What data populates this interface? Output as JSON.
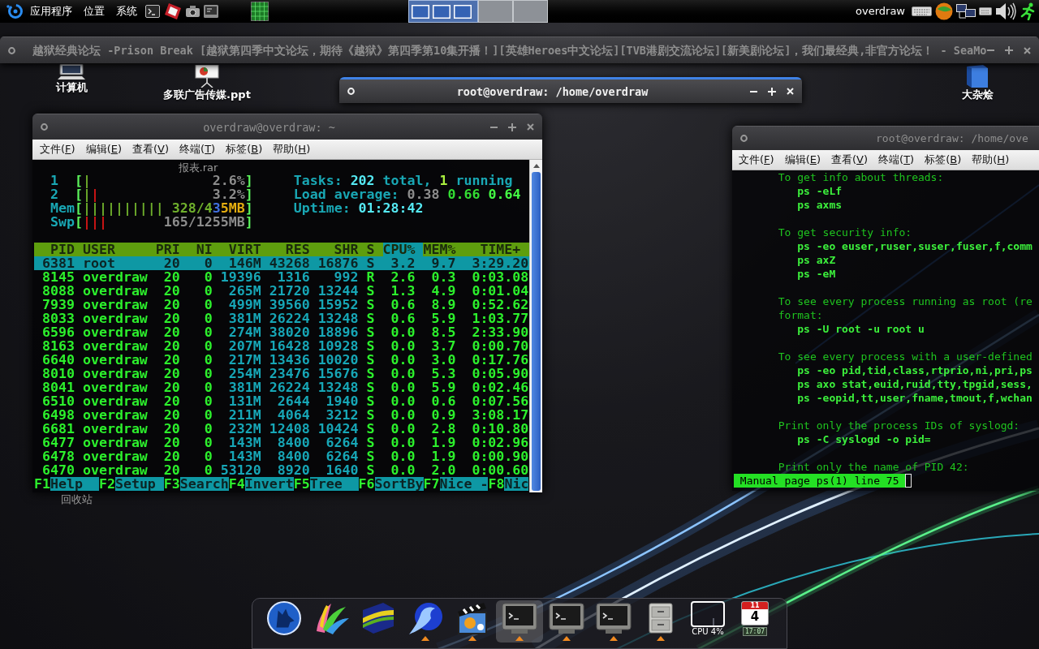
{
  "top_panel": {
    "menus": [
      "应用程序",
      "位置",
      "系统"
    ],
    "workspaces": [
      {
        "selected": true
      },
      {
        "selected": false
      },
      {
        "selected": false
      }
    ],
    "user": "overdraw"
  },
  "desktop_icons": [
    {
      "label": "计算机",
      "covered": false
    },
    {
      "label": "多联广告传媒.ppt",
      "covered": false
    },
    {
      "label": "大杂烩",
      "covered": false
    },
    {
      "label": "报表.rar",
      "covered": true
    },
    {
      "label": "回收站",
      "covered": true
    }
  ],
  "browser_window": {
    "title": "越狱经典论坛 -Prison Break [越狱第四季中文论坛，期待《越狱》第四季第10集开播！][英雄Heroes中文论坛][TVB港剧交流论坛][新美剧论坛]，我们最经典,非官方论坛！ - SeaMo",
    "focused": false
  },
  "terminal_window": {
    "title": "root@overdraw: /home/overdraw",
    "focused": true
  },
  "htop_window": {
    "title": "overdraw@overdraw: ~",
    "focused": false,
    "menu": [
      {
        "text": "文件(",
        "mnemonic": "F",
        "suffix": ")"
      },
      {
        "text": "编辑(",
        "mnemonic": "E",
        "suffix": ")"
      },
      {
        "text": "查看(",
        "mnemonic": "V",
        "suffix": ")"
      },
      {
        "text": "终端(",
        "mnemonic": "T",
        "suffix": ")"
      },
      {
        "text": "标签(",
        "mnemonic": "B",
        "suffix": ")"
      },
      {
        "text": "帮助(",
        "mnemonic": "H",
        "suffix": ")"
      }
    ],
    "htop": {
      "meters": [
        {
          "label": "1",
          "open": "[",
          "bar": [
            {
              "text": "|",
              "kind": "user"
            }
          ],
          "value": [
            {
              "text": "2.6%",
              "kind": "dim"
            }
          ],
          "close": "]"
        },
        {
          "label": "2",
          "open": "[",
          "bar": [
            {
              "text": "|",
              "kind": "user"
            },
            {
              "text": "|",
              "kind": "kernel"
            }
          ],
          "value": [
            {
              "text": "3.2%",
              "kind": "dim"
            }
          ],
          "close": "]"
        },
        {
          "label": "Mem",
          "open": "[",
          "bar": [
            {
              "text": "||||||||||",
              "kind": "user"
            }
          ],
          "value": [
            {
              "text": "328/4",
              "kind": "user"
            },
            {
              "text": "3",
              "kind": "buffers"
            },
            {
              "text": "5MB",
              "kind": "cache"
            }
          ],
          "close": "]"
        },
        {
          "label": "Swp",
          "open": "[",
          "bar": [
            {
              "text": "|||",
              "kind": "kernel"
            }
          ],
          "value": [
            {
              "text": "165/1255MB",
              "kind": "dim"
            }
          ],
          "close": "]"
        }
      ],
      "summary": [
        [
          {
            "text": "Tasks:",
            "kind": "label"
          },
          {
            "text": "202",
            "kind": "value"
          },
          {
            "text": "total,",
            "kind": "label"
          },
          {
            "text": "1",
            "kind": "running"
          },
          {
            "text": "running",
            "kind": "label"
          }
        ],
        [
          {
            "text": "Load average:",
            "kind": "label"
          },
          {
            "text": "0.38",
            "kind": "dim"
          },
          {
            "text": "0.66",
            "kind": "green"
          },
          {
            "text": "0.64",
            "kind": "bright"
          }
        ],
        [
          {
            "text": "Uptime:",
            "kind": "label"
          },
          {
            "text": "01:28:42",
            "kind": "value"
          }
        ]
      ],
      "columns": [
        {
          "label": "PID",
          "selected": false
        },
        {
          "label": "USER",
          "selected": false
        },
        {
          "label": "PRI",
          "selected": false
        },
        {
          "label": "NI",
          "selected": false
        },
        {
          "label": "VIRT",
          "selected": false
        },
        {
          "label": "RES",
          "selected": false
        },
        {
          "label": "SHR",
          "selected": false
        },
        {
          "label": "S",
          "selected": false
        },
        {
          "label": "CPU%",
          "selected": true
        },
        {
          "label": "MEM%",
          "selected": false
        },
        {
          "label": "TIME+",
          "selected": false
        }
      ],
      "rows": [
        {
          "selected": true,
          "cells": [
            "6381",
            "root",
            "20",
            "0",
            "146M",
            "43268",
            "16876",
            "S",
            "3.2",
            "9.7",
            "3:29.20"
          ]
        },
        {
          "selected": false,
          "cells": [
            "8145",
            "overdraw",
            "20",
            "0",
            "19396",
            "1316",
            "992",
            "R",
            "2.6",
            "0.3",
            "0:03.08"
          ]
        },
        {
          "selected": false,
          "cells": [
            "8088",
            "overdraw",
            "20",
            "0",
            "265M",
            "21720",
            "13244",
            "S",
            "1.3",
            "4.9",
            "0:01.04"
          ]
        },
        {
          "selected": false,
          "cells": [
            "7939",
            "overdraw",
            "20",
            "0",
            "499M",
            "39560",
            "15952",
            "S",
            "0.6",
            "8.9",
            "0:52.62"
          ]
        },
        {
          "selected": false,
          "cells": [
            "8033",
            "overdraw",
            "20",
            "0",
            "381M",
            "26224",
            "13248",
            "S",
            "0.6",
            "5.9",
            "1:03.77"
          ]
        },
        {
          "selected": false,
          "cells": [
            "6596",
            "overdraw",
            "20",
            "0",
            "274M",
            "38020",
            "18896",
            "S",
            "0.0",
            "8.5",
            "2:33.90"
          ]
        },
        {
          "selected": false,
          "cells": [
            "8163",
            "overdraw",
            "20",
            "0",
            "207M",
            "16428",
            "10928",
            "S",
            "0.0",
            "3.7",
            "0:00.70"
          ]
        },
        {
          "selected": false,
          "cells": [
            "6640",
            "overdraw",
            "20",
            "0",
            "217M",
            "13436",
            "10020",
            "S",
            "0.0",
            "3.0",
            "0:17.76"
          ]
        },
        {
          "selected": false,
          "cells": [
            "8010",
            "overdraw",
            "20",
            "0",
            "254M",
            "23476",
            "15676",
            "S",
            "0.0",
            "5.3",
            "0:05.90"
          ]
        },
        {
          "selected": false,
          "cells": [
            "8041",
            "overdraw",
            "20",
            "0",
            "381M",
            "26224",
            "13248",
            "S",
            "0.0",
            "5.9",
            "0:02.46"
          ]
        },
        {
          "selected": false,
          "cells": [
            "6510",
            "overdraw",
            "20",
            "0",
            "131M",
            "2644",
            "1940",
            "S",
            "0.0",
            "0.6",
            "0:07.56"
          ]
        },
        {
          "selected": false,
          "cells": [
            "6498",
            "overdraw",
            "20",
            "0",
            "211M",
            "4064",
            "3212",
            "S",
            "0.0",
            "0.9",
            "3:08.17"
          ]
        },
        {
          "selected": false,
          "cells": [
            "6681",
            "overdraw",
            "20",
            "0",
            "232M",
            "12408",
            "10424",
            "S",
            "0.0",
            "2.8",
            "0:10.80"
          ]
        },
        {
          "selected": false,
          "cells": [
            "6477",
            "overdraw",
            "20",
            "0",
            "143M",
            "8400",
            "6264",
            "S",
            "0.0",
            "1.9",
            "0:02.96"
          ]
        },
        {
          "selected": false,
          "cells": [
            "6478",
            "overdraw",
            "20",
            "0",
            "143M",
            "8400",
            "6264",
            "S",
            "0.0",
            "1.9",
            "0:00.90"
          ]
        },
        {
          "selected": false,
          "cells": [
            "6470",
            "overdraw",
            "20",
            "0",
            "53120",
            "8920",
            "1640",
            "S",
            "0.0",
            "2.0",
            "0:00.60"
          ]
        }
      ],
      "keys": [
        {
          "key": "F1",
          "label": "Help"
        },
        {
          "key": "F2",
          "label": "Setup"
        },
        {
          "key": "F3",
          "label": "Search"
        },
        {
          "key": "F4",
          "label": "Invert"
        },
        {
          "key": "F5",
          "label": "Tree"
        },
        {
          "key": "F6",
          "label": "SortBy"
        },
        {
          "key": "F7",
          "label": "Nice -"
        },
        {
          "key": "F8",
          "label": "Nic"
        }
      ]
    }
  },
  "man_window": {
    "title": "root@overdraw: /home/ove",
    "focused": false,
    "menu": [
      {
        "text": "文件(",
        "mnemonic": "F",
        "suffix": ")"
      },
      {
        "text": "编辑(",
        "mnemonic": "E",
        "suffix": ")"
      },
      {
        "text": "查看(",
        "mnemonic": "V",
        "suffix": ")"
      },
      {
        "text": "终端(",
        "mnemonic": "T",
        "suffix": ")"
      },
      {
        "text": "标签(",
        "mnemonic": "B",
        "suffix": ")"
      },
      {
        "text": "帮助(",
        "mnemonic": "H",
        "suffix": ")"
      }
    ],
    "lines": [
      {
        "kind": "text",
        "text": "To get info about threads:"
      },
      {
        "kind": "command",
        "text": "ps -eLf"
      },
      {
        "kind": "command",
        "text": "ps axms"
      },
      {
        "kind": "gap"
      },
      {
        "kind": "text",
        "text": "To get security info:"
      },
      {
        "kind": "command",
        "text": "ps -eo euser,ruser,suser,fuser,f,comm"
      },
      {
        "kind": "command",
        "text": "ps axZ"
      },
      {
        "kind": "command",
        "text": "ps -eM"
      },
      {
        "kind": "gap"
      },
      {
        "kind": "text",
        "text": "To see every process running as root (re"
      },
      {
        "kind": "text",
        "text": "format:"
      },
      {
        "kind": "command",
        "text": "ps -U root -u root u"
      },
      {
        "kind": "gap"
      },
      {
        "kind": "text",
        "text": "To see every process with a user-defined"
      },
      {
        "kind": "command",
        "text": "ps -eo pid,tid,class,rtprio,ni,pri,ps"
      },
      {
        "kind": "command",
        "text": "ps axo stat,euid,ruid,tty,tpgid,sess,"
      },
      {
        "kind": "command",
        "text": "ps -eopid,tt,user,fname,tmout,f,wchan"
      },
      {
        "kind": "gap"
      },
      {
        "kind": "text",
        "text": "Print only the process IDs of syslogd:"
      },
      {
        "kind": "command",
        "text": "ps -C syslogd -o pid="
      },
      {
        "kind": "gap"
      },
      {
        "kind": "text",
        "text": "Print only the name of PID 42:"
      }
    ],
    "status": "Manual page ps(1) line 75"
  },
  "dock": {
    "items": [
      {
        "kind": "app",
        "running": false,
        "selected": false
      },
      {
        "kind": "app",
        "running": false,
        "selected": false
      },
      {
        "kind": "app",
        "running": false,
        "selected": false
      },
      {
        "kind": "app",
        "running": true,
        "selected": false
      },
      {
        "kind": "app",
        "running": true,
        "selected": false
      },
      {
        "kind": "app",
        "running": true,
        "selected": true
      },
      {
        "kind": "app",
        "running": true,
        "selected": false
      },
      {
        "kind": "app",
        "running": true,
        "selected": false
      },
      {
        "kind": "app",
        "running": true,
        "selected": false
      },
      {
        "kind": "monitor",
        "label": "CPU 4%",
        "running": false,
        "selected": false
      },
      {
        "kind": "calendar",
        "month": "11",
        "day": "4",
        "time": "17:07",
        "running": false,
        "selected": false
      }
    ]
  }
}
